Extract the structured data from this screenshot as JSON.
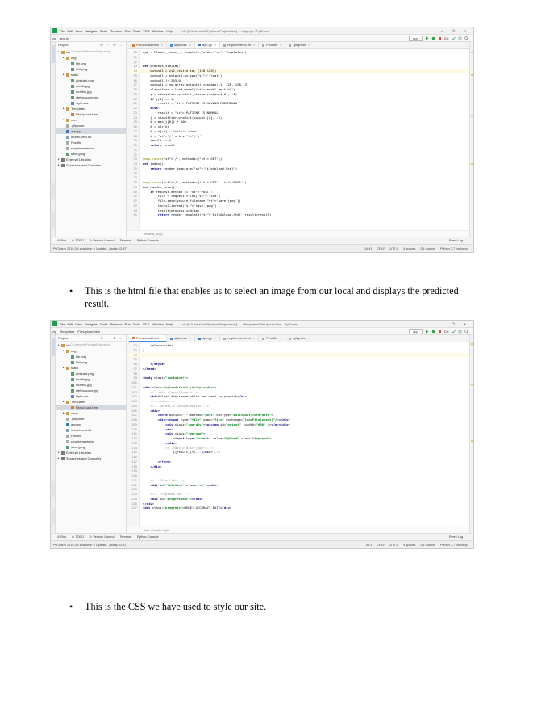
{
  "menu": {
    "items": [
      "File",
      "Edit",
      "View",
      "Navigate",
      "Code",
      "Refactor",
      "Run",
      "Tools",
      "VCS",
      "Window",
      "Help"
    ],
    "window_controls": [
      "–",
      "❐",
      "✕"
    ]
  },
  "run_toolbar": {
    "config": "app",
    "git_label": "Git:"
  },
  "screenshot1": {
    "window_title": "zip [C:\\Users\\hrit\\PycharmProjects\\zip] - ...\\app.py - PyCharm",
    "breadcrumbs": [
      "zip",
      "app.py"
    ],
    "tabs": [
      "FileUpload.html",
      "style.css",
      "app.py",
      "requirements.txt",
      "Procfile",
      ".gitignore"
    ],
    "active_tab": 2,
    "project_label": "Project",
    "tree": [
      {
        "depth": 0,
        "icon": "folder",
        "label": "zip",
        "note": "C:\\Users\\hrit\\PycharmProjects\\zip"
      },
      {
        "depth": 1,
        "icon": "folder",
        "label": "img"
      },
      {
        "depth": 2,
        "icon": "img",
        "label": "file.png"
      },
      {
        "depth": 2,
        "icon": "img",
        "label": "hhk.png"
      },
      {
        "depth": 1,
        "icon": "folder",
        "label": "static"
      },
      {
        "depth": 2,
        "icon": "img",
        "label": "abstract.png"
      },
      {
        "depth": 2,
        "icon": "img",
        "label": "health.jpg"
      },
      {
        "depth": 2,
        "icon": "img",
        "label": "health1.jpg"
      },
      {
        "depth": 2,
        "icon": "img",
        "label": "stethoscope.jpg"
      },
      {
        "depth": 2,
        "icon": "css",
        "label": "style.css"
      },
      {
        "depth": 1,
        "icon": "folder",
        "label": "Templates"
      },
      {
        "depth": 2,
        "icon": "html",
        "label": "FileUpload.html"
      },
      {
        "depth": 1,
        "icon": "folder",
        "label": "venv"
      },
      {
        "depth": 1,
        "icon": "txt",
        "label": ".gitignore"
      },
      {
        "depth": 1,
        "icon": "py",
        "label": "app.py",
        "selected": true
      },
      {
        "depth": 1,
        "icon": "file",
        "label": "model-best.h5"
      },
      {
        "depth": 1,
        "icon": "txt",
        "label": "Procfile"
      },
      {
        "depth": 1,
        "icon": "txt",
        "label": "requirements.txt"
      },
      {
        "depth": 1,
        "icon": "img",
        "label": "save.jpeg"
      },
      {
        "depth": 0,
        "icon": "lib",
        "label": "External Libraries"
      },
      {
        "depth": 0,
        "icon": "lib",
        "label": "Scratches and Consoles"
      }
    ],
    "code_lines": [
      {
        "n": "10",
        "t": "app = Flask(__name__, template_folder='Templates')"
      },
      {
        "n": "11",
        "t": ""
      },
      {
        "n": "12",
        "t": ""
      },
      {
        "n": "13",
        "t": "def process_xcd(im):"
      },
      {
        "n": "14",
        "t": "    output1 = cv2.resize(im, (128,128))",
        "hl": true
      },
      {
        "n": "15",
        "t": "    output1 = output1.astype('float')"
      },
      {
        "n": "16",
        "t": "    output1 /= 255.0"
      },
      {
        "n": "17",
        "t": "    output1 = np.array(output1).reshape(-1, 128, 128, 3)"
      },
      {
        "n": "18",
        "t": "    classifier = load_model('model-best.h5')"
      },
      {
        "n": "19",
        "t": "    y = classifier.predict_classes(output1[0], -1)"
      },
      {
        "n": "20",
        "t": "    if y[0] == 1:"
      },
      {
        "n": "21",
        "t": "        result = 'PATIENT IS HAVING PNEUMONIA '"
      },
      {
        "n": "22",
        "t": "    else:"
      },
      {
        "n": "23",
        "t": "        result = 'PATIENT IS NORMAL  '"
      },
      {
        "n": "24",
        "t": "    j = classifier.predict(output1[0], -1)"
      },
      {
        "n": "25",
        "t": "    k = max(j[0]) * 100"
      },
      {
        "n": "26",
        "t": "    k = str(k)"
      },
      {
        "n": "27",
        "t": "    k = k[:5] + '% Sure'"
      },
      {
        "n": "28",
        "t": "    k = '(' + k + ')'"
      },
      {
        "n": "29",
        "t": "    result += k"
      },
      {
        "n": "30",
        "t": "    return result"
      },
      {
        "n": "31",
        "t": ""
      },
      {
        "n": "32",
        "t": ""
      },
      {
        "n": "33",
        "t": "@app.route('/', methods=['GET'])"
      },
      {
        "n": "34",
        "t": "def index():"
      },
      {
        "n": "35",
        "t": "    return render_template('FileUpload.html')"
      },
      {
        "n": "36",
        "t": ""
      },
      {
        "n": "37",
        "t": ""
      },
      {
        "n": "38",
        "t": "@app.route('/', methods=['GET', 'POST'])"
      },
      {
        "n": "39",
        "t": "def handle_form():"
      },
      {
        "n": "40",
        "t": "    if request.method == 'POST':"
      },
      {
        "n": "41",
        "t": "        file = request.files['file']"
      },
      {
        "n": "42",
        "t": "        file.save(secure_filename('save.jpeg'))"
      },
      {
        "n": "43",
        "t": "        im=cv2.imread('save.jpeg')"
      },
      {
        "n": "44",
        "t": "        result=process_xcd(im)"
      },
      {
        "n": "45",
        "t": "        return render_template('FileUpload.html',result=result)"
      }
    ],
    "crumb": "process_xcd()",
    "status_left": "PyCharm 2019.3.4 available: // Update... (today 12:57)",
    "status_right": [
      "14:41",
      "CRLF",
      "UTF-8",
      "4 spaces",
      "Git: master",
      "Python 3.7 (webapp)"
    ]
  },
  "screenshot2": {
    "window_title": "zip [C:\\Users\\hrit\\PycharmProjects\\zip] - ...\\Templates\\FileUpload.html - PyCharm",
    "breadcrumbs": [
      "zip",
      "Templates",
      "FileUpload.html"
    ],
    "tabs": [
      "FileUpload.html",
      "style.css",
      "app.py",
      "requirements.txt",
      "Procfile",
      ".gitignore"
    ],
    "active_tab": 0,
    "project_label": "Project",
    "tree": [
      {
        "depth": 0,
        "icon": "folder",
        "label": "zip",
        "note": "C:\\Users\\hrit\\PycharmProjects\\zip"
      },
      {
        "depth": 1,
        "icon": "folder",
        "label": "img"
      },
      {
        "depth": 2,
        "icon": "img",
        "label": "file.png"
      },
      {
        "depth": 2,
        "icon": "img",
        "label": "hhk.png"
      },
      {
        "depth": 1,
        "icon": "folder",
        "label": "static"
      },
      {
        "depth": 2,
        "icon": "img",
        "label": "abstract.png"
      },
      {
        "depth": 2,
        "icon": "img",
        "label": "health.jpg"
      },
      {
        "depth": 2,
        "icon": "img",
        "label": "health1.jpg"
      },
      {
        "depth": 2,
        "icon": "img",
        "label": "stethoscope.jpg"
      },
      {
        "depth": 2,
        "icon": "css",
        "label": "style.css"
      },
      {
        "depth": 1,
        "icon": "folder",
        "label": "Templates"
      },
      {
        "depth": 2,
        "icon": "html",
        "label": "FileUpload.html",
        "selected": true
      },
      {
        "depth": 1,
        "icon": "folder",
        "label": "venv"
      },
      {
        "depth": 1,
        "icon": "txt",
        "label": ".gitignore"
      },
      {
        "depth": 1,
        "icon": "py",
        "label": "app.py"
      },
      {
        "depth": 1,
        "icon": "file",
        "label": "model-best.h5"
      },
      {
        "depth": 1,
        "icon": "txt",
        "label": "Procfile"
      },
      {
        "depth": 1,
        "icon": "txt",
        "label": "requirements.txt"
      },
      {
        "depth": 1,
        "icon": "img",
        "label": "save.jpeg"
      },
      {
        "depth": 0,
        "icon": "lib",
        "label": "External Libraries"
      },
      {
        "depth": 0,
        "icon": "lib",
        "label": "Scratches and Consoles"
      }
    ],
    "code_lines": [
      {
        "n": "92",
        "t": "    color:white;"
      },
      {
        "n": "93",
        "t": "}"
      },
      {
        "n": "94",
        "t": "",
        "hl": true
      },
      {
        "n": "95",
        "t": ""
      },
      {
        "n": "96",
        "t": "    </style>"
      },
      {
        "n": "97",
        "t": "</head>"
      },
      {
        "n": "98",
        "t": ""
      },
      {
        "n": "99",
        "t": "<body class=\"container\">"
      },
      {
        "n": "100",
        "t": ""
      },
      {
        "n": "101",
        "t": "<div class=\"upload-form\" id=\"uploader\">"
      },
      {
        "n": "102",
        "t": "    <!--<div class=\"jpgg\">-->"
      },
      {
        "n": "103",
        "t": "    <h4>Upload the image which you want to predict</h4>"
      },
      {
        "n": "104",
        "t": "    <!--</div>-->"
      },
      {
        "n": "105",
        "t": "    <!-- Select & Upload Button -->"
      },
      {
        "n": "106",
        "t": "    <div>"
      },
      {
        "n": "107",
        "t": "        <form action=\"/\" method=\"post\" enctype=\"multipart/form-data\">"
      },
      {
        "n": "108",
        "t": "        <div><input type=\"file\" name=\"file\" onchange=\"loadFile(event)\"/></div>"
      },
      {
        "n": "109",
        "t": "            <div class=\"img-div\"><p><img id=\"output\"  width=\"600\" /></p></div>"
      },
      {
        "n": "110",
        "t": "            <br>"
      },
      {
        "n": "111",
        "t": "            <div class=\"top-pad\">"
      },
      {
        "n": "112",
        "t": "                <input type=\"submit\" value=\"Upload\" class=\"top-pad\">"
      },
      {
        "n": "113",
        "t": "            </div>"
      },
      {
        "n": "114",
        "t": "            <!--<div class=\"jpgg\">-->"
      },
      {
        "n": "115",
        "t": "                {{result}}<!-- </div> -->"
      },
      {
        "n": "116",
        "t": ""
      },
      {
        "n": "117",
        "t": "        </form>"
      },
      {
        "n": "118",
        "t": "    </div>"
      },
      {
        "n": "119",
        "t": ""
      },
      {
        "n": "120",
        "t": ""
      },
      {
        "n": "121",
        "t": "    <!-- File List -->"
      },
      {
        "n": "122",
        "t": "    <div id=\"filelist\" class=\"ch\"></div>"
      },
      {
        "n": "123",
        "t": ""
      },
      {
        "n": "124",
        "t": "    <!-- Progress Bar -->"
      },
      {
        "n": "125",
        "t": "    <div id=\"progressbar\"></div>"
      },
      {
        "n": "126",
        "t": "</div>"
      },
      {
        "n": "127",
        "t": "<div class=\"progress\">HERE! ACCURACY RATE</div>"
      }
    ],
    "crumb": "html > head > style",
    "status_left": "PyCharm 2019.3.4 available: // Update... (today 12:57)",
    "status_right": [
      "48:1",
      "CRLF",
      "UTF-8",
      "4 spaces",
      "Git: master",
      "Python 3.7 (webapp)"
    ]
  },
  "bottom_tabs": [
    "4: Run",
    "6: TODO",
    "9: Version Control",
    "Terminal",
    "Python Console"
  ],
  "event_log": "Event Log",
  "bullets": {
    "b1": "This is the html file that enables us to select an image from our local and displays the predicted result.",
    "b2": "This is the CSS we have used to style our site."
  }
}
